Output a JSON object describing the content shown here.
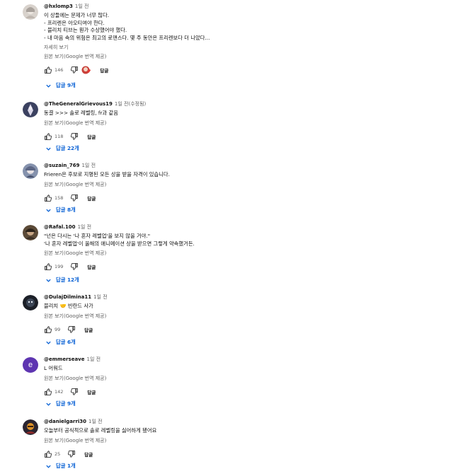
{
  "labels": {
    "translate": "원본 보기(Google 번역 제공)",
    "reply": "답글",
    "show_more": "자세히 보기"
  },
  "comments": [
    {
      "author": "@hxlomp3",
      "time": "1일 전",
      "lines": [
        "이 상들에는 문제가 너무 많다.",
        "- 프리렌은 아오티여야 한다.",
        "- 블리치 티브는 뭔가 수상했어야 했다.",
        "- 내 마음 속의 위험은 최고의 로맨스다. 몇 주 동안은 프리렌보다 더 나았다..."
      ],
      "likes": "146",
      "replies": "답글 9개",
      "avatar_color": "#cfcac6"
    },
    {
      "author": "@TheGeneralGrievous19",
      "time": "1일 전(수정됨)",
      "lines": [
        "동결 >>> 솔로 레벨링, fr과 같음"
      ],
      "likes": "118",
      "replies": "답글 22개",
      "avatar_color": "#3a3f5a"
    },
    {
      "author": "@suzain_769",
      "time": "1일 전",
      "lines": [
        "Frieren은 후보로 지명된 모든 상을 받을 자격이 있습니다."
      ],
      "likes": "158",
      "replies": "답글 8개",
      "avatar_color": "#7b88a6"
    },
    {
      "author": "@Rafal.100",
      "time": "1일 전",
      "lines": [
        "\"넌은 다시는 '나 혼자 레벨업'을 보지 않을 거야.\"",
        "'나 혼자 레벨업'이 올해의 애니메이션 상을 받으면 그렇게 약속했거든."
      ],
      "likes": "199",
      "replies": "답글 12개",
      "avatar_color": "#5a4a38"
    },
    {
      "author": "@DulajDilmina11",
      "time": "1일 전",
      "lines": [
        "블리치 🤝 빈란드 사가"
      ],
      "likes": "99",
      "replies": "답글 6개",
      "avatar_color": "#1c2028"
    },
    {
      "author": "@emmerseave",
      "time": "1일 전",
      "lines": [
        "L 어워드"
      ],
      "likes": "142",
      "replies": "답글 9개",
      "avatar_color": "#5e35b1",
      "avatar_letter": "e"
    },
    {
      "author": "@danielgarri30",
      "time": "1일 전",
      "lines": [
        "오늘부터 공식적으로 솔로 레벨링을 싫어하게 됐어요"
      ],
      "likes": "25",
      "replies": "답글 1개",
      "avatar_color": "#2a2430"
    }
  ]
}
